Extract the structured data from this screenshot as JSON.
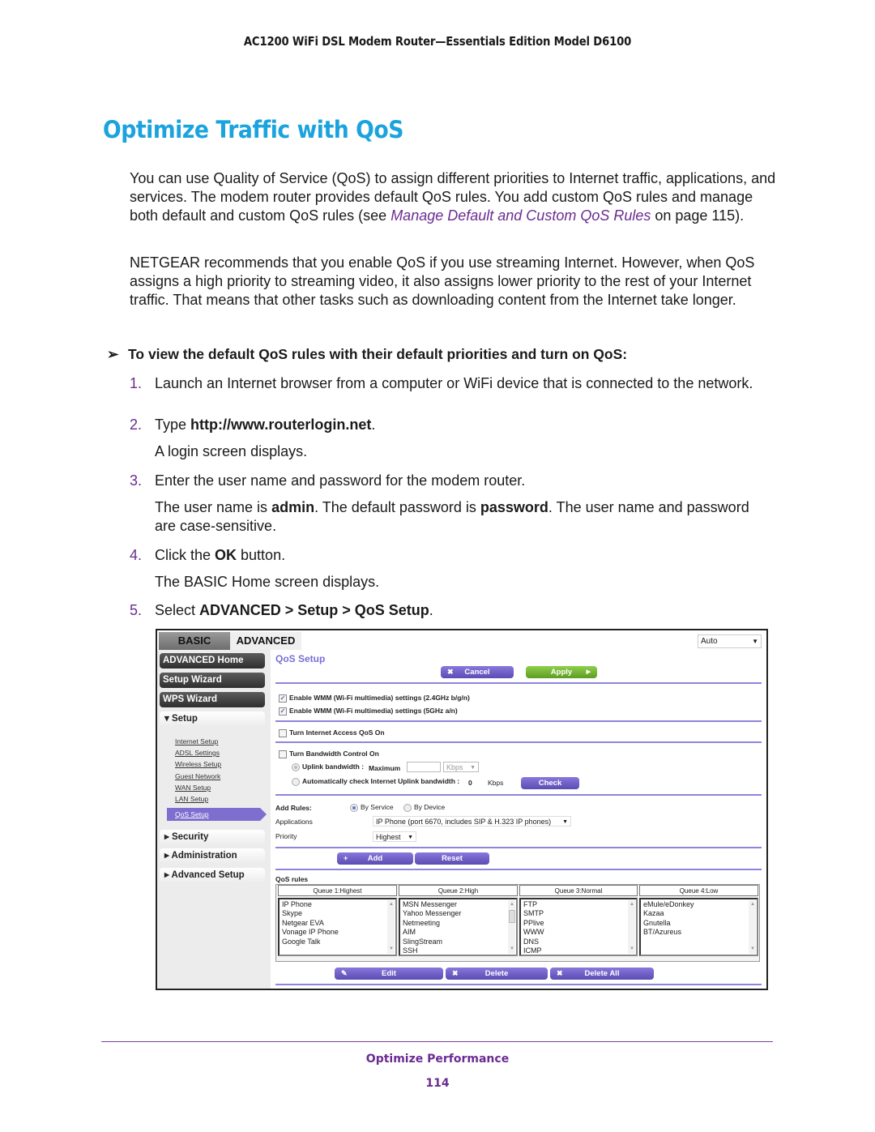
{
  "header": {
    "running_title": "AC1200 WiFi DSL Modem Router—Essentials Edition Model D6100"
  },
  "title": "Optimize Traffic with QoS",
  "intro": {
    "p1_before": "You can use Quality of Service (QoS) to assign different priorities to Internet traffic, applications, and services. The modem router provides default QoS rules. You add custom QoS rules and manage both default and custom QoS rules (see ",
    "p1_link": "Manage Default and Custom QoS Rules",
    "p1_after": " on page 115).",
    "p2": "NETGEAR recommends that you enable QoS if you use streaming Internet. However, when QoS assigns a high priority to streaming video, it also assigns lower priority to the rest of your Internet traffic. That means that other tasks such as downloading content from the Internet take longer."
  },
  "task": {
    "arrow": "➢",
    "text": "To view the default QoS rules with their default priorities and turn on QoS:"
  },
  "steps": [
    {
      "num": "1.",
      "text": "Launch an Internet browser from a computer or WiFi device that is connected to the network."
    },
    {
      "num": "2.",
      "pre": "Type ",
      "bold": "http://www.routerlogin.net",
      "post": ".",
      "note": "A login screen displays."
    },
    {
      "num": "3.",
      "text": "Enter the user name and password for the modem router.",
      "note_parts": [
        "The user name is ",
        "admin",
        ". The default password is ",
        "password",
        ". The user name and password are case-sensitive."
      ]
    },
    {
      "num": "4.",
      "pre": "Click the ",
      "bold": "OK",
      "post": " button.",
      "note": "The BASIC Home screen displays."
    },
    {
      "num": "5.",
      "pre": "Select ",
      "bold": "ADVANCED > Setup > QoS Setup",
      "post": "."
    }
  ],
  "screenshot": {
    "tabs": {
      "basic": "BASIC",
      "advanced": "ADVANCED"
    },
    "language_select": "Auto",
    "sidebar": {
      "advanced_home": "ADVANCED Home",
      "setup_wizard": "Setup Wizard",
      "wps_wizard": "WPS Wizard",
      "setup": "▾ Setup",
      "setup_items": [
        "Internet Setup",
        "ADSL Settings",
        "Wireless Setup",
        "Guest Network",
        "WAN Setup",
        "LAN Setup"
      ],
      "active_item": "QoS Setup",
      "security": "▸ Security",
      "administration": "▸ Administration",
      "advanced_setup": "▸ Advanced Setup"
    },
    "page_title": "QoS Setup",
    "cancel": "Cancel",
    "apply": "Apply",
    "wmm_24": "Enable WMM (Wi-Fi multimedia) settings (2.4GHz b/g/n)",
    "wmm_5": "Enable WMM (Wi-Fi multimedia) settings (5GHz a/n)",
    "wmm_24_checked": true,
    "wmm_5_checked": true,
    "internet_qos": "Turn Internet Access QoS On",
    "bandwidth_control": "Turn Bandwidth Control On",
    "uplink_label": "Uplink bandwidth :",
    "maximum_label": "Maximum",
    "maximum_value": "",
    "unit": "Kbps",
    "auto_check_label": "Automatically check Internet Uplink bandwidth :",
    "auto_value": "0",
    "auto_unit": "Kbps",
    "check": "Check",
    "add_rules": "Add Rules:",
    "by_service": "By Service",
    "by_device": "By Device",
    "applications_label": "Applications",
    "applications_value": "IP Phone (port 6670, includes SIP & H.323 IP phones)",
    "priority_label": "Priority",
    "priority_value": "Highest",
    "add": "Add",
    "reset": "Reset",
    "rules_title": "QoS rules",
    "queues": [
      {
        "header": "Queue 1:Highest",
        "items": [
          "IP Phone",
          "Skype",
          "Netgear EVA",
          "Vonage IP Phone",
          "Google Talk"
        ]
      },
      {
        "header": "Queue 2:High",
        "items": [
          "MSN Messenger",
          "Yahoo Messenger",
          "Netmeeting",
          "AIM",
          "SlingStream",
          "SSH"
        ]
      },
      {
        "header": "Queue 3:Normal",
        "items": [
          "FTP",
          "SMTP",
          "PPlive",
          "WWW",
          "DNS",
          "ICMP"
        ]
      },
      {
        "header": "Queue 4:Low",
        "items": [
          "eMule/eDonkey",
          "Kazaa",
          "Gnutella",
          "BT/Azureus"
        ]
      }
    ],
    "edit": "Edit",
    "delete": "Delete",
    "delete_all": "Delete All"
  },
  "footer": {
    "section": "Optimize Performance",
    "page": "114"
  }
}
